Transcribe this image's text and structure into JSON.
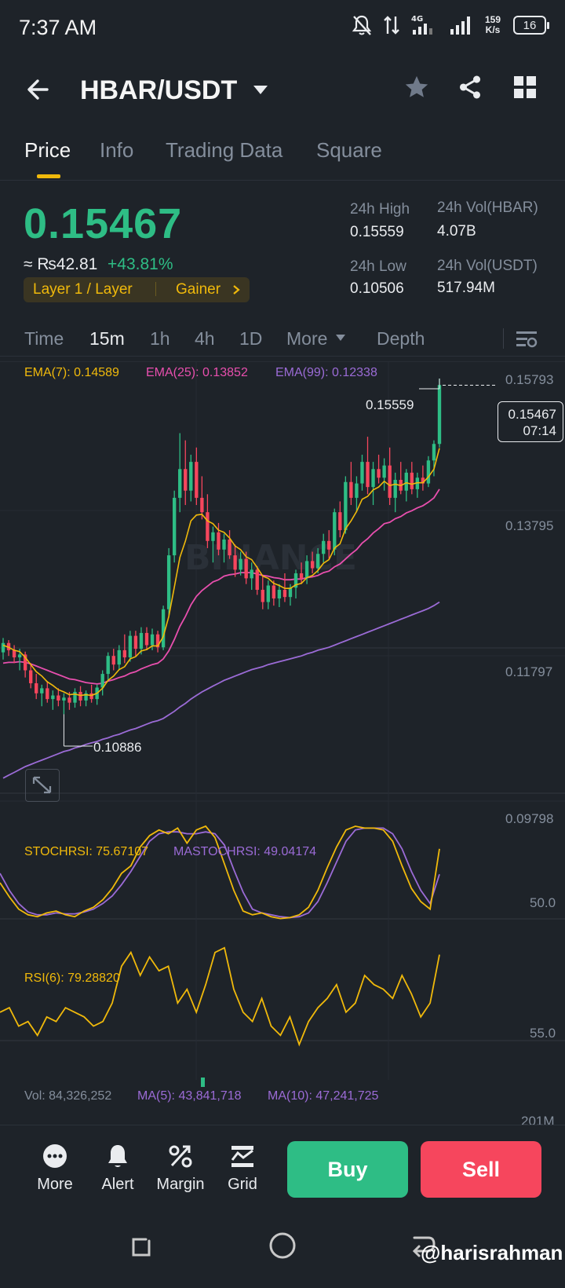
{
  "status_bar": {
    "time": "7:37 AM",
    "net_speed": "159 K/s",
    "network": "4G",
    "battery": "16"
  },
  "header": {
    "pair": "HBAR/USDT"
  },
  "tabs": [
    {
      "label": "Price",
      "active": true
    },
    {
      "label": "Info",
      "active": false
    },
    {
      "label": "Trading Data",
      "active": false
    },
    {
      "label": "Square",
      "active": false
    }
  ],
  "ticker": {
    "last_price": "0.15467",
    "fiat": "≈ ₨42.81",
    "change": "+43.81%",
    "tag_category": "Layer 1 / Layer",
    "tag_badge": "Gainer",
    "high_label": "24h High",
    "high": "0.15559",
    "low_label": "24h Low",
    "low": "0.10506",
    "vol_base_label": "24h Vol(HBAR)",
    "vol_base": "4.07B",
    "vol_quote_label": "24h Vol(USDT)",
    "vol_quote": "517.94M"
  },
  "intervals": {
    "time": "Time",
    "m15": "15m",
    "h1": "1h",
    "h4": "4h",
    "d1": "1D",
    "more": "More",
    "depth": "Depth"
  },
  "chart": {
    "ema7": "EMA(7): 0.14589",
    "ema25": "EMA(25): 0.13852",
    "ema99": "EMA(99): 0.12338",
    "axis_prices": [
      "0.15793",
      "0.13795",
      "0.11797",
      "0.09798"
    ],
    "high_marker": "0.15559",
    "low_marker": "0.10886",
    "current_price": "0.15467",
    "countdown": "07:14",
    "watermark": "BINANCE",
    "stoch_label": "STOCHRSI: 75.67107",
    "mastoch_label": "MASTOCHRSI: 49.04174",
    "stoch_axis": "50.0",
    "rsi_label": "RSI(6): 79.28820",
    "rsi_axis": "55.0",
    "vol_label": "Vol: 84,326,252",
    "ma5_label": "MA(5): 43,841,718",
    "ma10_label": "MA(10): 47,241,725",
    "vol_axis": "201M",
    "colors": {
      "up": "#2ebd85",
      "down": "#f6465d",
      "ema7": "#f0b90b",
      "ema25": "#e84fae",
      "ema99": "#9b6bd6"
    }
  },
  "chart_data": {
    "type": "candlestick",
    "description_series": "15m candles HBAR/USDT",
    "ylim": [
      0.0979,
      0.158
    ],
    "candles": [
      [
        0.1175,
        0.1195,
        0.1165,
        0.1188
      ],
      [
        0.1188,
        0.1192,
        0.117,
        0.1178
      ],
      [
        0.1178,
        0.1185,
        0.116,
        0.1168
      ],
      [
        0.1168,
        0.118,
        0.115,
        0.1172
      ],
      [
        0.1172,
        0.1176,
        0.114,
        0.115
      ],
      [
        0.115,
        0.116,
        0.1125,
        0.1132
      ],
      [
        0.1132,
        0.1145,
        0.111,
        0.1118
      ],
      [
        0.1118,
        0.113,
        0.11,
        0.1125
      ],
      [
        0.1125,
        0.1135,
        0.1105,
        0.111
      ],
      [
        0.111,
        0.1122,
        0.1095,
        0.1115
      ],
      [
        0.1115,
        0.1125,
        0.11,
        0.1108
      ],
      [
        0.1108,
        0.1118,
        0.1089,
        0.1112
      ],
      [
        0.1112,
        0.112,
        0.1095,
        0.1105
      ],
      [
        0.1105,
        0.1125,
        0.1098,
        0.112
      ],
      [
        0.112,
        0.1128,
        0.11,
        0.1108
      ],
      [
        0.1108,
        0.1122,
        0.11,
        0.1118
      ],
      [
        0.1118,
        0.113,
        0.1105,
        0.111
      ],
      [
        0.111,
        0.113,
        0.1102,
        0.1126
      ],
      [
        0.1126,
        0.115,
        0.1115,
        0.1145
      ],
      [
        0.1145,
        0.1175,
        0.1135,
        0.117
      ],
      [
        0.117,
        0.118,
        0.115,
        0.1158
      ],
      [
        0.1158,
        0.1185,
        0.115,
        0.1178
      ],
      [
        0.1178,
        0.12,
        0.116,
        0.1168
      ],
      [
        0.1168,
        0.1205,
        0.1162,
        0.1198
      ],
      [
        0.1198,
        0.1205,
        0.117,
        0.118
      ],
      [
        0.118,
        0.121,
        0.1172,
        0.1202
      ],
      [
        0.1202,
        0.121,
        0.1178,
        0.1185
      ],
      [
        0.1185,
        0.1208,
        0.1178,
        0.12
      ],
      [
        0.12,
        0.1205,
        0.1175,
        0.1182
      ],
      [
        0.1182,
        0.124,
        0.1178,
        0.1235
      ],
      [
        0.1235,
        0.132,
        0.1225,
        0.131
      ],
      [
        0.131,
        0.14,
        0.13,
        0.139
      ],
      [
        0.139,
        0.148,
        0.137,
        0.143
      ],
      [
        0.143,
        0.147,
        0.138,
        0.14
      ],
      [
        0.14,
        0.145,
        0.1385,
        0.144
      ],
      [
        0.144,
        0.146,
        0.138,
        0.139
      ],
      [
        0.139,
        0.142,
        0.136,
        0.137
      ],
      [
        0.137,
        0.1395,
        0.132,
        0.133
      ],
      [
        0.133,
        0.135,
        0.13,
        0.1342
      ],
      [
        0.1342,
        0.1355,
        0.131,
        0.1318
      ],
      [
        0.1318,
        0.134,
        0.13,
        0.1332
      ],
      [
        0.1332,
        0.1345,
        0.1305,
        0.131
      ],
      [
        0.131,
        0.1325,
        0.128,
        0.129
      ],
      [
        0.129,
        0.1315,
        0.1282,
        0.1305
      ],
      [
        0.1305,
        0.1315,
        0.127,
        0.1278
      ],
      [
        0.1278,
        0.13,
        0.1262,
        0.129
      ],
      [
        0.129,
        0.1295,
        0.1255,
        0.1262
      ],
      [
        0.1262,
        0.128,
        0.1235,
        0.1245
      ],
      [
        0.1245,
        0.1275,
        0.1235,
        0.1268
      ],
      [
        0.1268,
        0.1275,
        0.124,
        0.125
      ],
      [
        0.125,
        0.127,
        0.1238,
        0.1262
      ],
      [
        0.1262,
        0.1285,
        0.1245,
        0.1252
      ],
      [
        0.1252,
        0.127,
        0.124,
        0.1265
      ],
      [
        0.1265,
        0.129,
        0.125,
        0.1285
      ],
      [
        0.1285,
        0.13,
        0.127,
        0.1278
      ],
      [
        0.1278,
        0.131,
        0.127,
        0.1302
      ],
      [
        0.1302,
        0.1315,
        0.1285,
        0.1292
      ],
      [
        0.1292,
        0.132,
        0.1285,
        0.1312
      ],
      [
        0.1312,
        0.134,
        0.13,
        0.133
      ],
      [
        0.133,
        0.1345,
        0.1305,
        0.1318
      ],
      [
        0.1318,
        0.1375,
        0.131,
        0.137
      ],
      [
        0.137,
        0.1385,
        0.1335,
        0.1345
      ],
      [
        0.1345,
        0.142,
        0.134,
        0.1412
      ],
      [
        0.1412,
        0.144,
        0.138,
        0.139
      ],
      [
        0.139,
        0.142,
        0.137,
        0.141
      ],
      [
        0.141,
        0.145,
        0.14,
        0.144
      ],
      [
        0.144,
        0.1475,
        0.1395,
        0.1405
      ],
      [
        0.1405,
        0.144,
        0.138,
        0.143
      ],
      [
        0.143,
        0.145,
        0.141,
        0.1418
      ],
      [
        0.1418,
        0.1445,
        0.14,
        0.1435
      ],
      [
        0.1435,
        0.146,
        0.138,
        0.139
      ],
      [
        0.139,
        0.1425,
        0.137,
        0.1415
      ],
      [
        0.1415,
        0.144,
        0.1395,
        0.14
      ],
      [
        0.14,
        0.143,
        0.1385,
        0.1425
      ],
      [
        0.1425,
        0.144,
        0.1395,
        0.1402
      ],
      [
        0.1402,
        0.1425,
        0.139,
        0.1418
      ],
      [
        0.1418,
        0.1435,
        0.14,
        0.141
      ],
      [
        0.141,
        0.1448,
        0.1405,
        0.1442
      ],
      [
        0.1442,
        0.147,
        0.142,
        0.1465
      ],
      [
        0.1465,
        0.1556,
        0.146,
        0.1547
      ]
    ],
    "ema7": [
      0.1185,
      0.1182,
      0.1178,
      0.1176,
      0.1168,
      0.1158,
      0.1148,
      0.1142,
      0.1134,
      0.1129,
      0.1123,
      0.112,
      0.1116,
      0.1117,
      0.1115,
      0.1116,
      0.1115,
      0.1118,
      0.1125,
      0.1136,
      0.1142,
      0.1151,
      0.1155,
      0.1166,
      0.1169,
      0.1177,
      0.1179,
      0.1184,
      0.1184,
      0.1197,
      0.1225,
      0.1266,
      0.1307,
      0.133,
      0.1358,
      0.1366,
      0.1367,
      0.1358,
      0.1354,
      0.1345,
      0.1342,
      0.1334,
      0.1323,
      0.1318,
      0.1308,
      0.1304,
      0.1293,
      0.1281,
      0.1278,
      0.1271,
      0.1268,
      0.1264,
      0.1264,
      0.1269,
      0.1271,
      0.1279,
      0.1282,
      0.1289,
      0.1299,
      0.1304,
      0.132,
      0.1326,
      0.1347,
      0.1358,
      0.1371,
      0.1388,
      0.1392,
      0.1401,
      0.1405,
      0.1413,
      0.1407,
      0.1409,
      0.1407,
      0.1411,
      0.1409,
      0.1411,
      0.1411,
      0.1419,
      0.143,
      0.1459
    ],
    "ema25": [
      0.116,
      0.1161,
      0.1161,
      0.1162,
      0.1161,
      0.1159,
      0.1156,
      0.1153,
      0.115,
      0.1147,
      0.1144,
      0.1141,
      0.1138,
      0.1137,
      0.1135,
      0.1133,
      0.1132,
      0.1131,
      0.1132,
      0.1135,
      0.1137,
      0.114,
      0.1142,
      0.1146,
      0.1148,
      0.1152,
      0.1155,
      0.1158,
      0.116,
      0.1166,
      0.1177,
      0.1193,
      0.1211,
      0.1225,
      0.1241,
      0.1253,
      0.1261,
      0.1267,
      0.1273,
      0.1276,
      0.1281,
      0.1283,
      0.1284,
      0.1286,
      0.1286,
      0.1286,
      0.1284,
      0.1282,
      0.1281,
      0.1279,
      0.1278,
      0.1276,
      0.1276,
      0.1277,
      0.1277,
      0.1279,
      0.128,
      0.1282,
      0.1286,
      0.1288,
      0.1294,
      0.1298,
      0.1305,
      0.1312,
      0.1318,
      0.1327,
      0.1333,
      0.1341,
      0.1347,
      0.1354,
      0.1356,
      0.1361,
      0.1364,
      0.1369,
      0.1372,
      0.1376,
      0.1379,
      0.1384,
      0.139,
      0.1402
    ],
    "ema99": [
      0.1,
      0.1004,
      0.1008,
      0.1012,
      0.1016,
      0.1019,
      0.1022,
      0.1025,
      0.1028,
      0.1031,
      0.1034,
      0.1037,
      0.1039,
      0.1042,
      0.1044,
      0.1047,
      0.1049,
      0.1051,
      0.1054,
      0.1056,
      0.1059,
      0.1061,
      0.1064,
      0.1067,
      0.1069,
      0.1072,
      0.1075,
      0.1078,
      0.108,
      0.1083,
      0.1088,
      0.1093,
      0.1099,
      0.1104,
      0.111,
      0.1115,
      0.112,
      0.1124,
      0.1128,
      0.1132,
      0.1136,
      0.1139,
      0.1142,
      0.1145,
      0.1148,
      0.1151,
      0.1153,
      0.1155,
      0.1158,
      0.116,
      0.1162,
      0.1164,
      0.1166,
      0.1168,
      0.117,
      0.1173,
      0.1175,
      0.1178,
      0.118,
      0.1182,
      0.1185,
      0.1188,
      0.1191,
      0.1194,
      0.1197,
      0.12,
      0.1203,
      0.1206,
      0.1209,
      0.1212,
      0.1215,
      0.1218,
      0.1221,
      0.1224,
      0.1227,
      0.123,
      0.1233,
      0.1236,
      0.124,
      0.1245
    ],
    "stochrsi": [
      40,
      25,
      12,
      6,
      4,
      8,
      10,
      6,
      4,
      10,
      14,
      22,
      34,
      50,
      58,
      78,
      90,
      96,
      92,
      98,
      82,
      96,
      100,
      88,
      60,
      32,
      10,
      6,
      8,
      4,
      2,
      3,
      6,
      14,
      32,
      56,
      78,
      96,
      100,
      98,
      98,
      96,
      84,
      58,
      34,
      20,
      12,
      76
    ],
    "mastochrsi": [
      50,
      32,
      18,
      9,
      6,
      6,
      8,
      7,
      7,
      9,
      12,
      18,
      26,
      38,
      52,
      68,
      84,
      92,
      94,
      94,
      92,
      92,
      94,
      92,
      80,
      54,
      30,
      12,
      8,
      6,
      4,
      3,
      4,
      8,
      20,
      40,
      62,
      84,
      96,
      98,
      98,
      98,
      92,
      76,
      52,
      32,
      18,
      49
    ],
    "rsi6": [
      54,
      56,
      48,
      50,
      44,
      52,
      50,
      56,
      54,
      52,
      48,
      50,
      58,
      74,
      80,
      70,
      78,
      72,
      74,
      58,
      64,
      54,
      66,
      80,
      82,
      64,
      54,
      50,
      60,
      48,
      44,
      52,
      40,
      50,
      56,
      60,
      66,
      54,
      58,
      70,
      66,
      64,
      60,
      70,
      62,
      52,
      58,
      79
    ],
    "volume_last": 84326252,
    "volume_axis_max": "201M"
  },
  "bottom_bar": {
    "more": "More",
    "alert": "Alert",
    "margin": "Margin",
    "grid": "Grid",
    "buy": "Buy",
    "sell": "Sell"
  },
  "watermark_user": "@harisrahman"
}
